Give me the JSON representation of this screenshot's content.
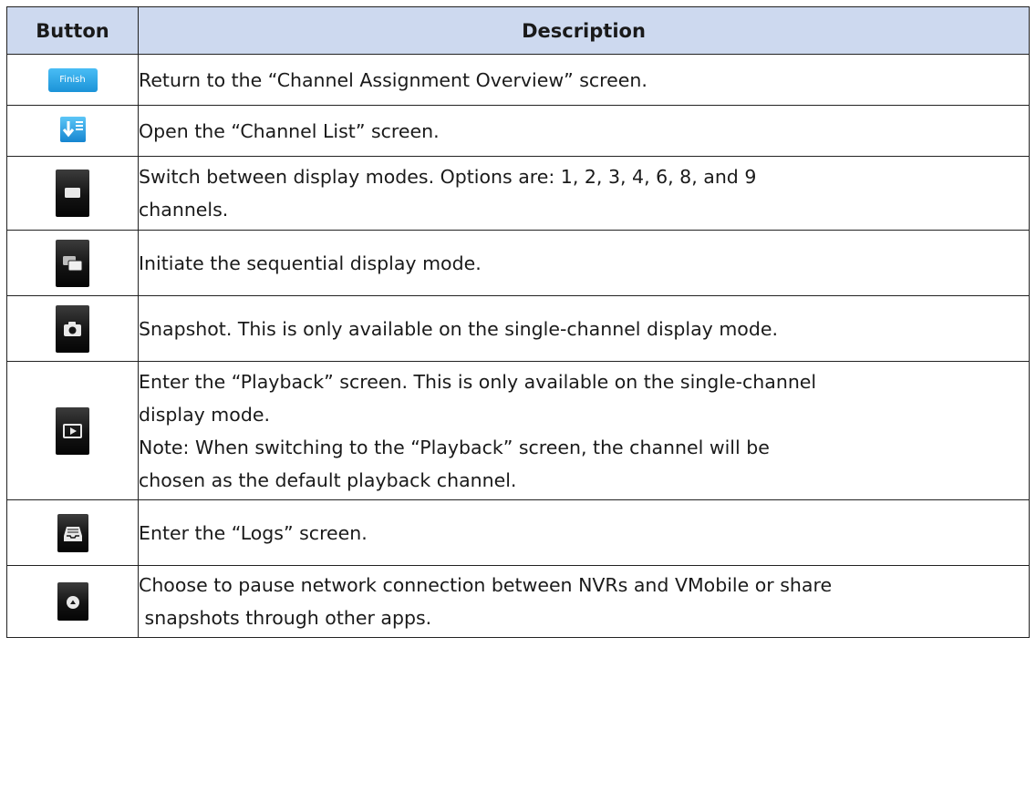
{
  "table": {
    "header_button": "Button",
    "header_description": "Description",
    "rows": [
      {
        "icon": "finish-button-icon",
        "button_label": "Finish",
        "lines": [
          "Return to the “Channel Assignment Overview” screen."
        ]
      },
      {
        "icon": "channel-list-icon",
        "lines": [
          "Open the “Channel List” screen."
        ]
      },
      {
        "icon": "display-mode-icon",
        "lines": [
          "Switch between display modes.   Options are: 1, 2, 3, 4, 6, 8, and 9",
          "channels."
        ]
      },
      {
        "icon": "sequential-display-icon",
        "lines": [
          "Initiate the sequential display mode."
        ]
      },
      {
        "icon": "camera-icon",
        "lines": [
          "Snapshot. This is only available on the single-channel display mode."
        ]
      },
      {
        "icon": "playback-icon",
        "lines": [
          "Enter the “Playback” screen. This is only available on the single-channel",
          "display mode.",
          "Note: When switching to the “Playback” screen, the channel will be",
          "chosen as the default playback channel."
        ]
      },
      {
        "icon": "logs-tray-icon",
        "lines": [
          "Enter the “Logs” screen."
        ]
      },
      {
        "icon": "more-options-icon",
        "lines": [
          "Choose to pause network connection between NVRs and VMobile or share",
          " snapshots through other apps."
        ]
      }
    ]
  }
}
